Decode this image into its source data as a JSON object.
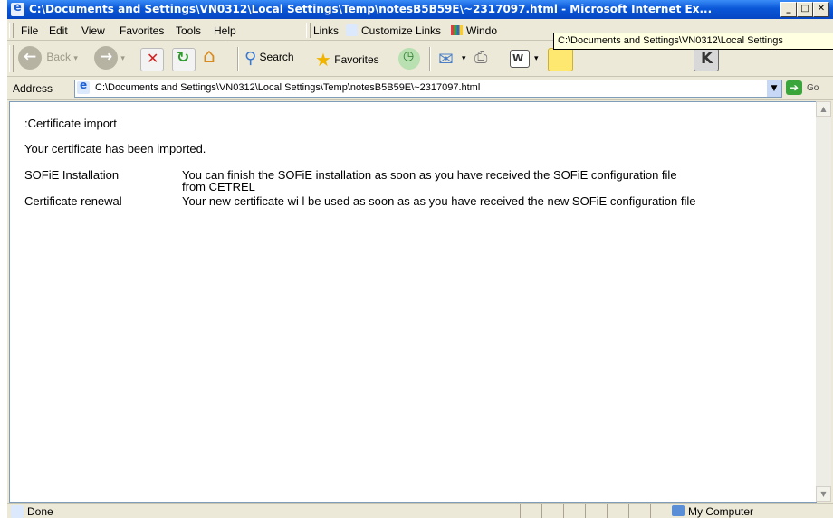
{
  "window": {
    "title": "C:\\Documents and Settings\\VN0312\\Local Settings\\Temp\\notesB5B59E\\~2317097.html - Microsoft Internet Ex...",
    "minimize": "_",
    "maximize": "□",
    "close": "✕"
  },
  "menu": {
    "file": "File",
    "edit": "Edit",
    "view": "View",
    "favorites": "Favorites",
    "tools": "Tools",
    "help": "Help"
  },
  "links": {
    "label": "Links",
    "customize": "Customize Links",
    "windows": "Windo"
  },
  "tooltip": "C:\\Documents and Settings\\VN0312\\Local Settings",
  "toolbar": {
    "back": "Back",
    "search": "Search",
    "favorites": "Favorites"
  },
  "address": {
    "label": "Address",
    "value": "C:\\Documents and Settings\\VN0312\\Local Settings\\Temp\\notesB5B59E\\~2317097.html",
    "go": "Go"
  },
  "content": {
    "heading": ":Certificate import",
    "message": "Your certificate has been imported.",
    "rows": [
      {
        "label": "SOFiE Installation",
        "text_line1": "You can finish the SOFiE installation as soon as you have received the SOFiE configuration file",
        "text_line2": "from CETREL"
      },
      {
        "label": "Certificate renewal",
        "text_line1": "Your new certificate wi l be used as soon as as you have received the new SOFiE configuration file"
      }
    ]
  },
  "status": {
    "text": "Done",
    "zone": "My Computer"
  },
  "colors": {
    "titlebar": "#0a57d8",
    "chrome": "#ece9d8",
    "content_bg": "#ffffff"
  }
}
